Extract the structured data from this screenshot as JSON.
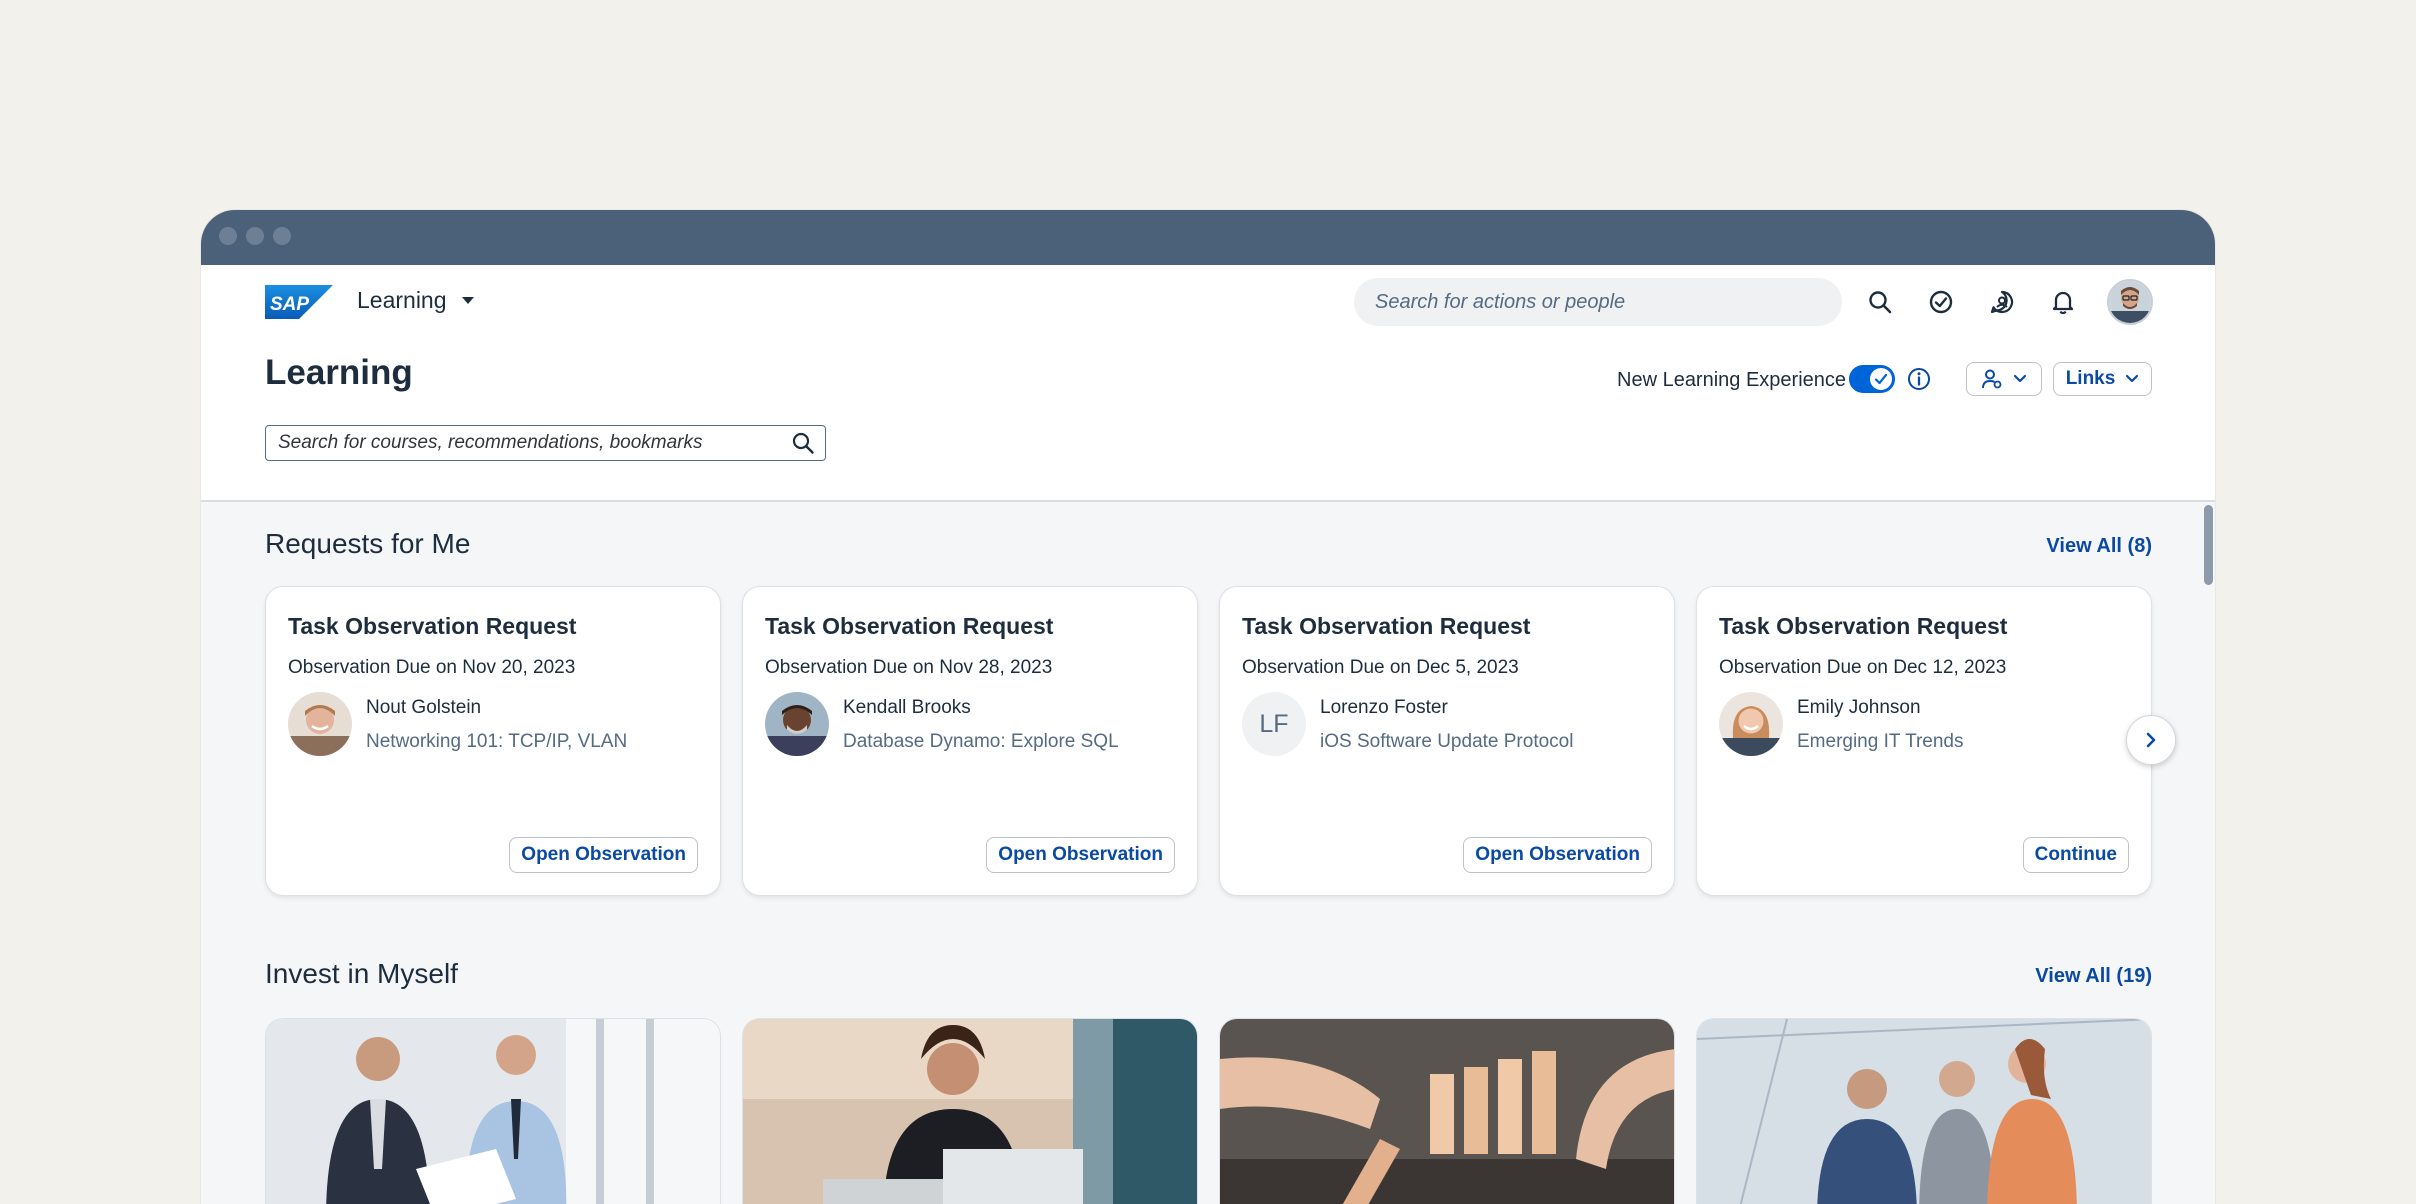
{
  "shell": {
    "app_name": "Learning",
    "search_placeholder": "Search for actions or people"
  },
  "header": {
    "page_title": "Learning",
    "new_experience_label": "New Learning Experience",
    "new_experience_enabled": true,
    "links_label": "Links",
    "search_placeholder": "Search for courses, recommendations, bookmarks"
  },
  "requests": {
    "title": "Requests for Me",
    "view_all": "View All (8)",
    "cards": [
      {
        "title": "Task Observation Request",
        "due": "Observation Due on Nov 20, 2023",
        "name": "Nout Golstein",
        "course": "Networking 101: TCP/IP, VLAN",
        "button": "Open Observation"
      },
      {
        "title": "Task Observation Request",
        "due": "Observation Due on Nov 28, 2023",
        "name": "Kendall Brooks",
        "course": "Database Dynamo: Explore SQL",
        "button": "Open Observation"
      },
      {
        "title": "Task Observation Request",
        "due": "Observation Due on Dec 5, 2023",
        "name": "Lorenzo Foster",
        "initials": "LF",
        "course": "iOS Software Update Protocol",
        "button": "Open Observation"
      },
      {
        "title": "Task Observation Request",
        "due": "Observation Due on Dec 12, 2023",
        "name": "Emily Johnson",
        "course": "Emerging IT Trends",
        "button": "Continue"
      }
    ]
  },
  "invest": {
    "title": "Invest in Myself",
    "view_all": "View All (19)"
  },
  "colors": {
    "accent": "#0064d9",
    "link": "#0a4aa5",
    "titlebar": "#4b6079"
  }
}
